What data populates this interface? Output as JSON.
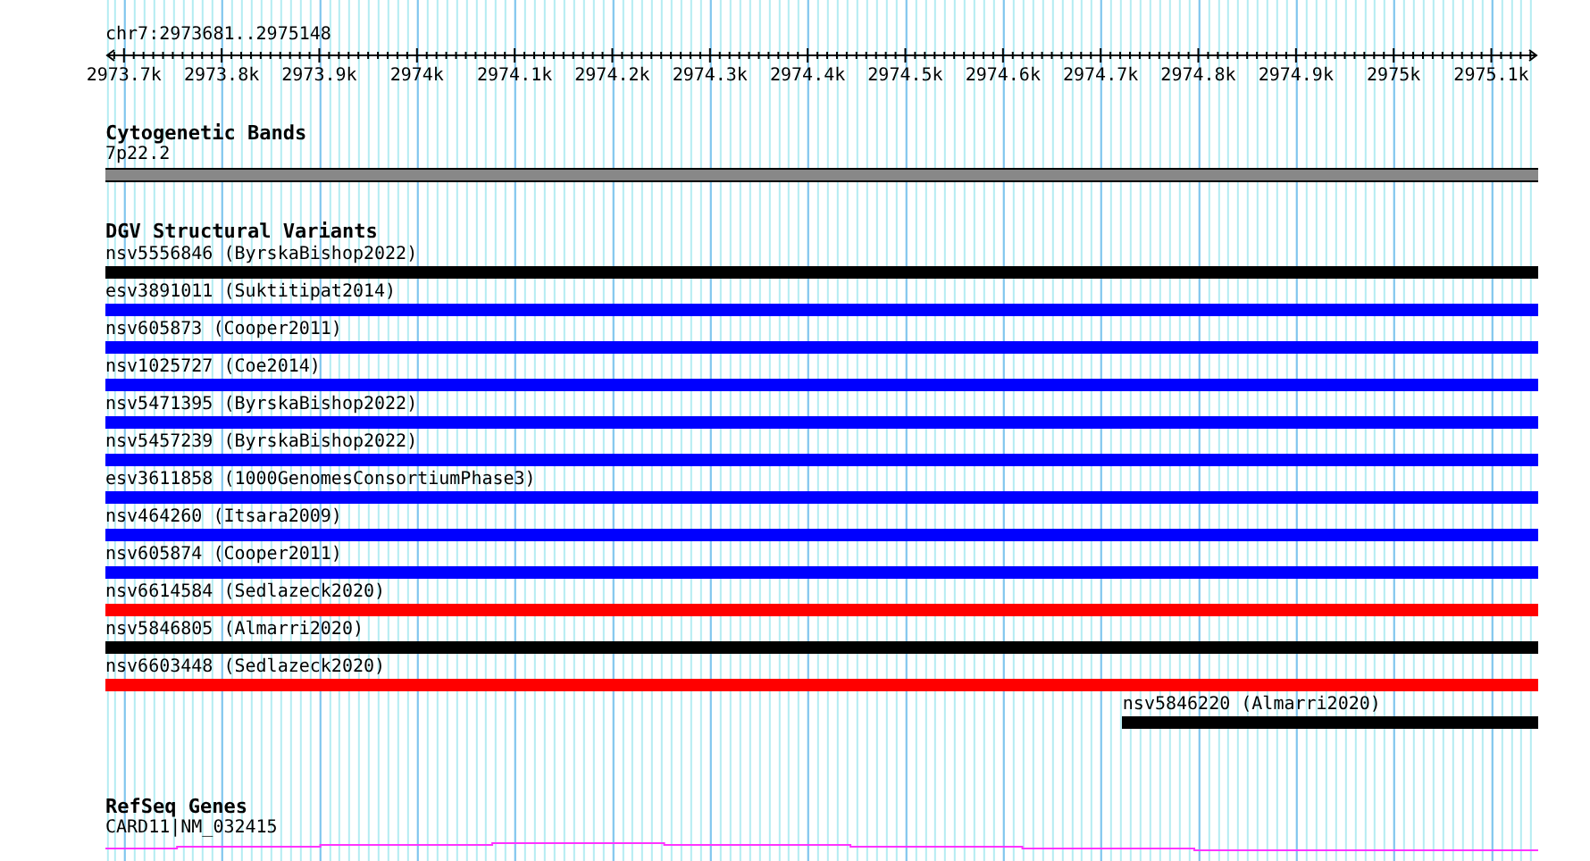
{
  "ruler": {
    "region": "chr7:2973681..2975148",
    "tick_labels": [
      "2973.7k",
      "2973.8k",
      "2973.9k",
      "2974k",
      "2974.1k",
      "2974.2k",
      "2974.3k",
      "2974.4k",
      "2974.5k",
      "2974.6k",
      "2974.7k",
      "2974.8k",
      "2974.9k",
      "2975k",
      "2975.1k"
    ]
  },
  "cytobands": {
    "title": "Cytogenetic Bands",
    "band": "7p22.2"
  },
  "variants": {
    "title": "DGV Structural Variants",
    "features": [
      {
        "label": "nsv5556846 (ByrskaBishop2022)",
        "color": "#000000",
        "level": 1
      },
      {
        "label": "esv3891011 (Suktitipat2014)",
        "color": "#0000ff",
        "level": 1
      },
      {
        "label": "nsv605873 (Cooper2011)",
        "color": "#0000ff",
        "level": 1
      },
      {
        "label": "nsv1025727 (Coe2014)",
        "color": "#0000ff",
        "level": 1
      },
      {
        "label": "nsv5471395 (ByrskaBishop2022)",
        "color": "#0000ff",
        "level": 1
      },
      {
        "label": "nsv5457239 (ByrskaBishop2022)",
        "color": "#0000ff",
        "level": 1
      },
      {
        "label": "esv3611858 (1000GenomesConsortiumPhase3)",
        "color": "#0000ff",
        "level": 1
      },
      {
        "label": "nsv464260 (Itsara2009)",
        "color": "#0000ff",
        "level": 1
      },
      {
        "label": "nsv605874 (Cooper2011)",
        "color": "#0000ff",
        "level": 1
      },
      {
        "label": "nsv6614584 (Sedlazeck2020)",
        "color": "#ff0000",
        "level": 1
      },
      {
        "label": "nsv5846805 (Almarri2020)",
        "color": "#000000",
        "level": 1
      },
      {
        "label": "nsv6603448 (Sedlazeck2020)",
        "color": "#ff0000",
        "level": 1
      },
      {
        "label": "nsv5846220 (Almarri2020)",
        "color": "#000000",
        "level": 0.29
      }
    ]
  },
  "genes": {
    "title": "RefSeq Genes",
    "features": [
      {
        "label": "CARD11|NM_032415"
      }
    ]
  }
}
